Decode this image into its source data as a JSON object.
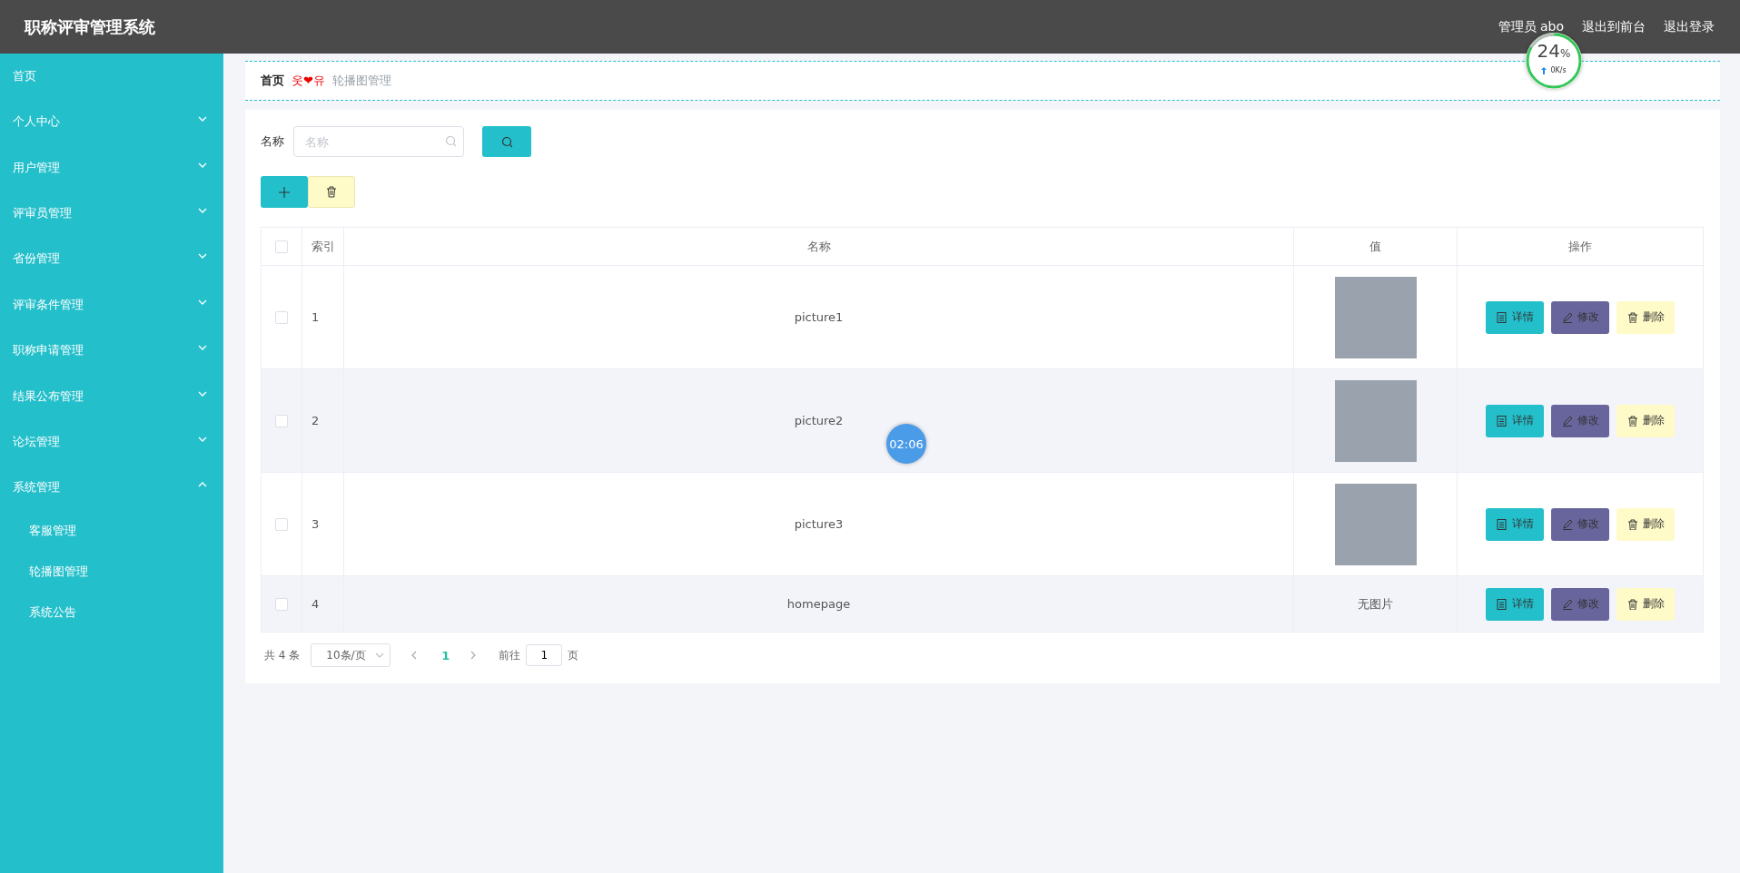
{
  "header": {
    "title": "职称评审管理系统",
    "links": [
      "管理员 abo",
      "退出到前台",
      "退出登录"
    ]
  },
  "sidebar": {
    "items": [
      {
        "label": "首页",
        "kind": "link"
      },
      {
        "label": "个人中心",
        "kind": "menu",
        "expanded": false
      },
      {
        "label": "用户管理",
        "kind": "menu",
        "expanded": false
      },
      {
        "label": "评审员管理",
        "kind": "menu",
        "expanded": false
      },
      {
        "label": "省份管理",
        "kind": "menu",
        "expanded": false
      },
      {
        "label": "评审条件管理",
        "kind": "menu",
        "expanded": false
      },
      {
        "label": "职称申请管理",
        "kind": "menu",
        "expanded": false
      },
      {
        "label": "结果公布管理",
        "kind": "menu",
        "expanded": false
      },
      {
        "label": "论坛管理",
        "kind": "menu",
        "expanded": false
      },
      {
        "label": "系统管理",
        "kind": "menu",
        "expanded": true,
        "children": [
          {
            "label": "客服管理"
          },
          {
            "label": "轮播图管理"
          },
          {
            "label": "系统公告"
          }
        ]
      }
    ]
  },
  "breadcrumb": {
    "home": "首页",
    "separator": "웃❤유",
    "current": "轮播图管理"
  },
  "search": {
    "label": "名称",
    "placeholder": "名称"
  },
  "table": {
    "select_all_checked": false,
    "columns": [
      "索引",
      "名称",
      "值",
      "操作"
    ],
    "rows": [
      {
        "checked": false,
        "index": "1",
        "name": "picture1",
        "value": {
          "kind": "image"
        },
        "actions": [
          "详情",
          "修改",
          "删除"
        ]
      },
      {
        "checked": false,
        "index": "2",
        "name": "picture2",
        "value": {
          "kind": "image"
        },
        "actions": [
          "详情",
          "修改",
          "删除"
        ]
      },
      {
        "checked": false,
        "index": "3",
        "name": "picture3",
        "value": {
          "kind": "image"
        },
        "actions": [
          "详情",
          "修改",
          "删除"
        ]
      },
      {
        "checked": false,
        "index": "4",
        "name": "homepage",
        "value": {
          "kind": "text",
          "text": "无图片"
        },
        "actions": [
          "详情",
          "修改",
          "删除"
        ]
      }
    ]
  },
  "pagination": {
    "total": "共 4 条",
    "page_size": "10条/页",
    "pages": [
      {
        "label": "1",
        "selected": true
      }
    ],
    "goto_label": "前往",
    "goto_value": "1",
    "goto_suffix": "页"
  },
  "speed_widget": {
    "percent": "24",
    "unit": "%",
    "rate": "0K/s"
  },
  "timer_bubble": {
    "time": "02:06"
  }
}
